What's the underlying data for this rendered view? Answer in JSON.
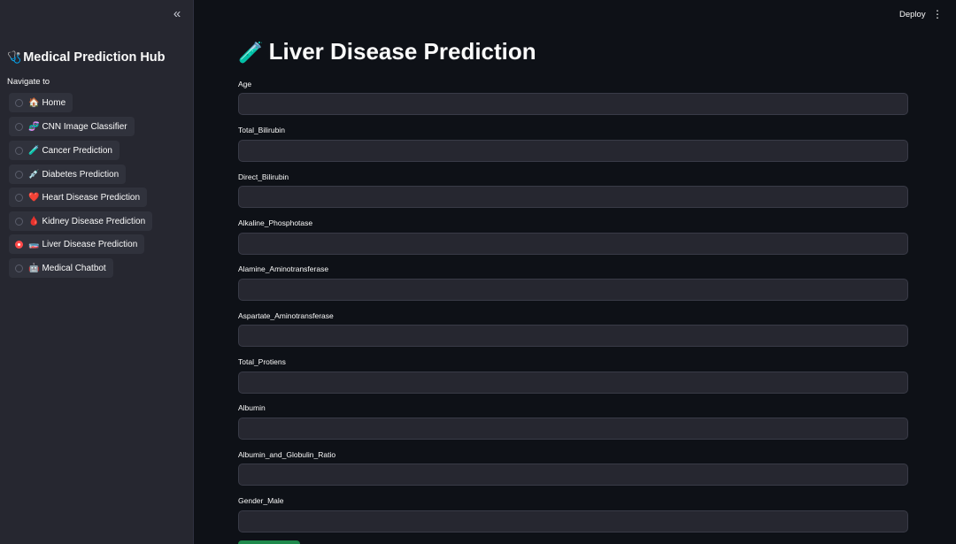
{
  "sidebar": {
    "title_emoji": "🩺",
    "title": "Medical Prediction Hub",
    "nav_label": "Navigate to",
    "items": [
      {
        "emoji": "🏠",
        "label": "Home",
        "selected": false
      },
      {
        "emoji": "🧬",
        "label": "CNN Image Classifier",
        "selected": false
      },
      {
        "emoji": "🧪",
        "label": "Cancer Prediction",
        "selected": false
      },
      {
        "emoji": "💉",
        "label": "Diabetes Prediction",
        "selected": false
      },
      {
        "emoji": "❤️",
        "label": "Heart Disease Prediction",
        "selected": false
      },
      {
        "emoji": "🩸",
        "label": "Kidney Disease Prediction",
        "selected": false
      },
      {
        "emoji": "🧫",
        "label": "Liver Disease Prediction",
        "selected": true
      },
      {
        "emoji": "🤖",
        "label": "Medical Chatbot",
        "selected": false
      }
    ]
  },
  "header": {
    "deploy_label": "Deploy"
  },
  "main": {
    "title_emoji": "🧪",
    "title": "Liver Disease Prediction",
    "fields": [
      {
        "label": "Age",
        "value": ""
      },
      {
        "label": "Total_Bilirubin",
        "value": ""
      },
      {
        "label": "Direct_Bilirubin",
        "value": ""
      },
      {
        "label": "Alkaline_Phosphotase",
        "value": ""
      },
      {
        "label": "Alamine_Aminotransferase",
        "value": ""
      },
      {
        "label": "Aspartate_Aminotransferase",
        "value": ""
      },
      {
        "label": "Total_Protiens",
        "value": ""
      },
      {
        "label": "Albumin",
        "value": ""
      },
      {
        "label": "Albumin_and_Globulin_Ratio",
        "value": ""
      },
      {
        "label": "Gender_Male",
        "value": ""
      }
    ]
  },
  "colors": {
    "background": "#0e1117",
    "sidebar": "#262730",
    "accent": "#ff4b4b",
    "submit": "#1f8a4c"
  }
}
